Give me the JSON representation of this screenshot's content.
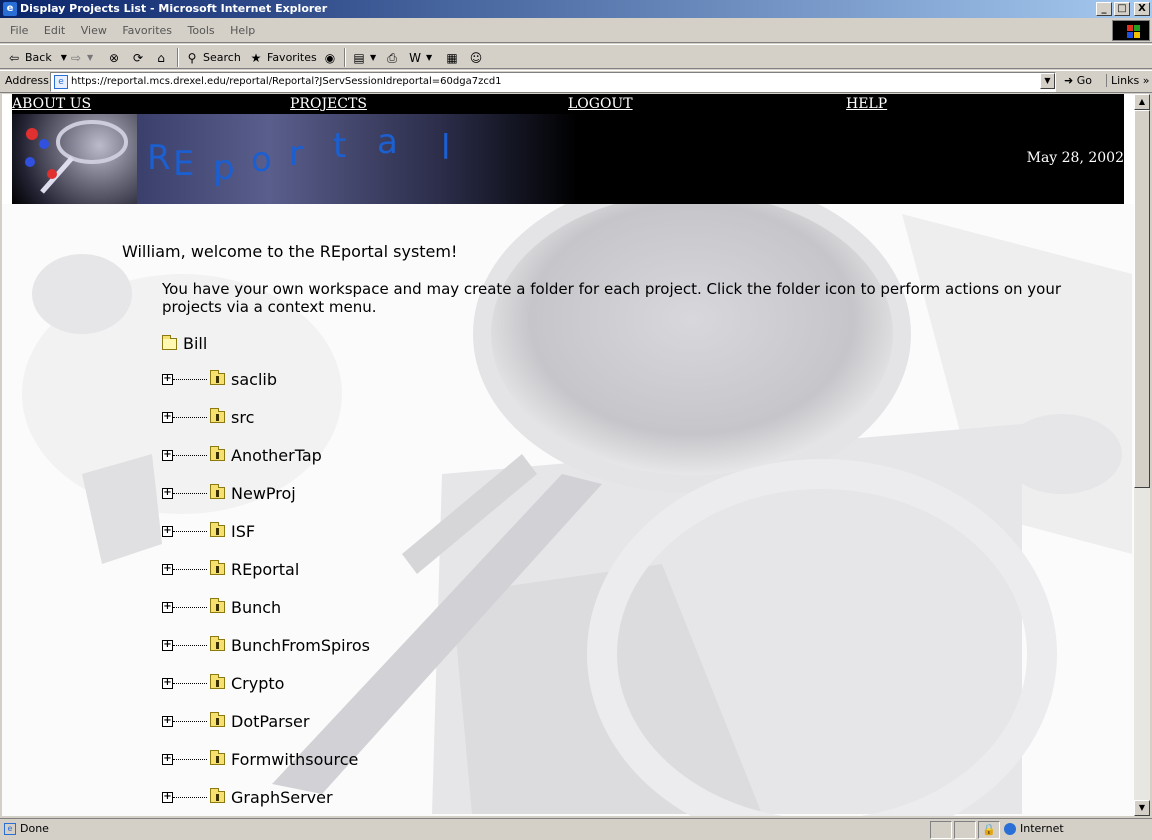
{
  "window": {
    "title": "Display Projects List - Microsoft Internet Explorer",
    "buttons": {
      "minimize": "_",
      "maximize": "□",
      "close": "X"
    }
  },
  "menu": [
    "File",
    "Edit",
    "View",
    "Favorites",
    "Tools",
    "Help"
  ],
  "toolbar": {
    "back_label": "Back",
    "search_label": "Search",
    "favorites_label": "Favorites"
  },
  "address": {
    "label": "Address",
    "url": "https://reportal.mcs.drexel.edu/reportal/Reportal?JServSessionIdreportal=60dga7zcd1",
    "go_label": "Go",
    "links_label": "Links"
  },
  "nav": {
    "about": "ABOUT US",
    "projects": "PROJECTS",
    "logout": "LOGOUT",
    "help": "HELP"
  },
  "logo": {
    "letters": [
      "R",
      "E",
      "p",
      "o",
      "r",
      "t",
      "a",
      "l"
    ]
  },
  "date": "May 28, 2002",
  "welcome": "William, welcome to the REportal system!",
  "intro": "You have your own workspace and may create a folder for each project. Click the folder icon to perform actions on your projects via a context menu.",
  "tree": {
    "root": "Bill",
    "expand_symbol": "+",
    "projects": [
      "saclib",
      "src",
      "AnotherTap",
      "NewProj",
      "ISF",
      "REportal",
      "Bunch",
      "BunchFromSpiros",
      "Crypto",
      "DotParser",
      "Formwithsource",
      "GraphServer"
    ]
  },
  "status": {
    "text": "Done",
    "zone": "Internet"
  },
  "colors": {
    "titlebar_start": "#0a246a",
    "titlebar_end": "#a6caf0",
    "logo_text": "#1b5fd0",
    "banner_bg": "#000000",
    "folder": "#f5e070"
  }
}
